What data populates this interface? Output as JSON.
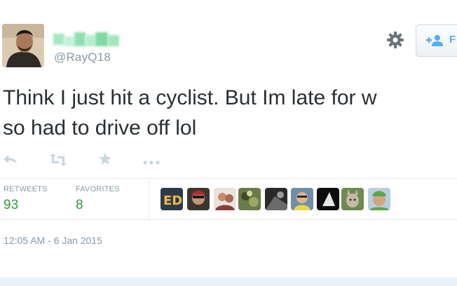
{
  "tweet": {
    "handle": "@RayQ18",
    "text_line1": "Think I just hit a cyclist. But Im late for w",
    "text_line2": "so had to drive off lol",
    "follow_label": "F",
    "timestamp": "12:05 AM - 6 Jan 2015"
  },
  "stats": {
    "retweets_label": "RETWEETS",
    "retweets_value": "93",
    "favorites_label": "FAVORITES",
    "favorites_value": "8"
  },
  "icons": {
    "reply": "reply-icon",
    "retweet": "retweet-icon",
    "favorite": "star-icon",
    "more": "more-icon",
    "settings": "gear-icon",
    "follow": "add-user-icon"
  },
  "favoriters": [
    "face-1",
    "face-2",
    "face-3",
    "face-4",
    "face-5",
    "face-6",
    "face-7",
    "face-8",
    "face-9"
  ],
  "colors": {
    "accent": "#55acee",
    "count": "#2a9d3a",
    "muted": "#8899a6",
    "text": "#292f33"
  }
}
